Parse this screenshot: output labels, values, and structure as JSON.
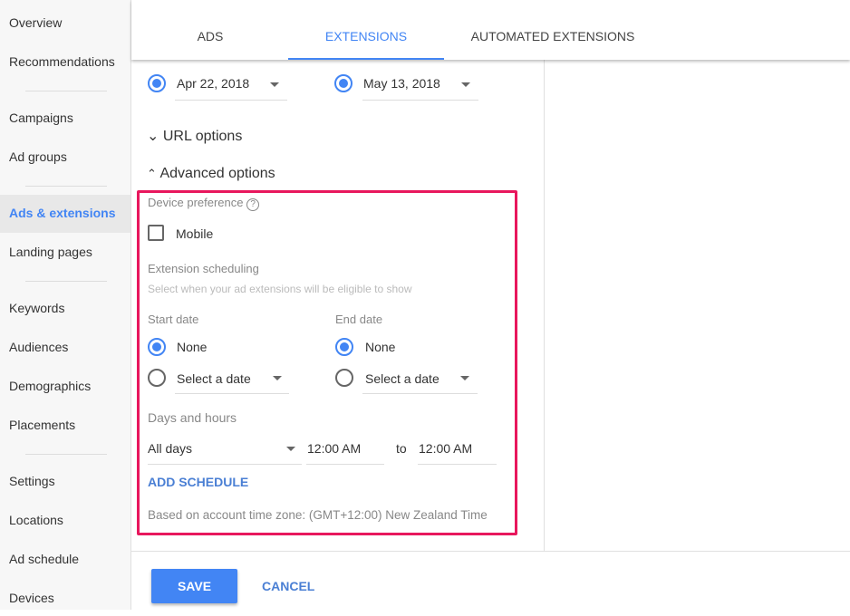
{
  "sidebar": {
    "items": [
      {
        "label": "Overview"
      },
      {
        "label": "Recommendations"
      },
      {
        "label": "Campaigns"
      },
      {
        "label": "Ad groups"
      },
      {
        "label": "Ads & extensions",
        "active": true
      },
      {
        "label": "Landing pages"
      },
      {
        "label": "Keywords"
      },
      {
        "label": "Audiences"
      },
      {
        "label": "Demographics"
      },
      {
        "label": "Placements"
      },
      {
        "label": "Settings"
      },
      {
        "label": "Locations"
      },
      {
        "label": "Ad schedule"
      },
      {
        "label": "Devices"
      }
    ]
  },
  "tabs": [
    {
      "label": "ADS"
    },
    {
      "label": "EXTENSIONS",
      "active": true
    },
    {
      "label": "AUTOMATED EXTENSIONS"
    }
  ],
  "form": {
    "start_date_value": "Apr 22, 2018",
    "end_date_value": "May 13, 2018",
    "url_options": "URL options",
    "advanced_options": "Advanced options",
    "device_preference": "Device preference",
    "mobile": "Mobile",
    "mobile_checked": false,
    "ext_scheduling": "Extension scheduling",
    "ext_scheduling_hint": "Select when your ad extensions will be eligible to show",
    "start_date": "Start date",
    "end_date": "End date",
    "none": "None",
    "select_date": "Select a date",
    "days_hours": "Days and hours",
    "days": "All days",
    "from_time": "12:00 AM",
    "to": "to",
    "to_time": "12:00 AM",
    "add_schedule": "ADD SCHEDULE",
    "timezone": "Based on account time zone: (GMT+12:00) New Zealand Time"
  },
  "footer": {
    "save": "SAVE",
    "cancel": "CANCEL"
  },
  "colors": {
    "accent": "#4285f4",
    "highlight": "#e8175d"
  }
}
